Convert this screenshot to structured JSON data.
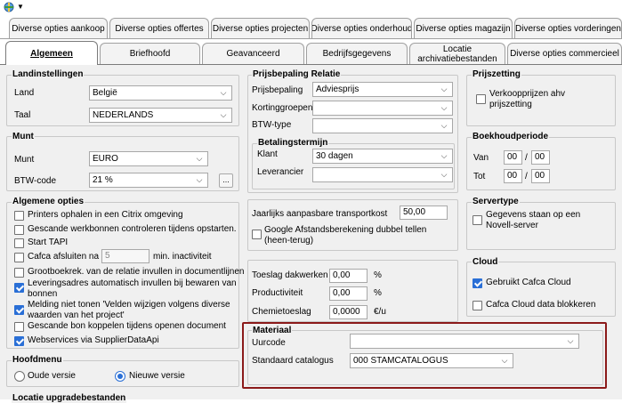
{
  "tabs_row1": [
    "Diverse opties aankoop",
    "Diverse opties offertes",
    "Diverse opties projecten",
    "Diverse opties onderhoud",
    "Diverse opties magazijn",
    "Diverse opties vorderingen"
  ],
  "tabs_row2": [
    "Algemeen",
    "Briefhoofd",
    "Geavanceerd",
    "Bedrijfsgegevens",
    "Locatie archivatiebestanden",
    "Diverse opties commercieel"
  ],
  "landinstellingen": {
    "title": "Landinstellingen",
    "land_label": "Land",
    "land_value": "België",
    "taal_label": "Taal",
    "taal_value": "NEDERLANDS"
  },
  "munt": {
    "title": "Munt",
    "munt_label": "Munt",
    "munt_value": "EURO",
    "btw_label": "BTW-code",
    "btw_value": "21 %",
    "dots": "..."
  },
  "algemene_opties": {
    "title": "Algemene opties",
    "printers": "Printers ophalen in een Citrix omgeving",
    "gescande": "Gescande werkbonnen controleren tijdens opstarten.",
    "tapi": "Start TAPI",
    "cafca_pre": "Cafca afsluiten na",
    "cafca_value": "5",
    "cafca_post": "min. inactiviteit",
    "grootboek": "Grootboekrek. van de relatie invullen in documentlijnen",
    "leverings1": "Leveringsadres automatisch invullen bij bewaren van",
    "leverings2": "bonnen",
    "melding1": "Melding niet tonen 'Velden wijzigen volgens diverse",
    "melding2": "waarden van het project'",
    "gescande_bon": "Gescande bon koppelen tijdens openen document",
    "webservices": "Webservices via SupplierDataApi"
  },
  "hoofdmenu": {
    "title": "Hoofdmenu",
    "oude": "Oude versie",
    "nieuwe": "Nieuwe versie"
  },
  "locatie_upgrade": {
    "title": "Locatie upgradebestanden"
  },
  "prijsbepaling": {
    "title": "Prijsbepaling Relatie",
    "prijsbepaling_label": "Prijsbepaling",
    "prijsbepaling_value": "Adviesprijs",
    "korting_label": "Kortinggroepen",
    "btw_type_label": "BTW-type"
  },
  "betalingstermijn": {
    "title": "Betalingstermijn",
    "klant_label": "Klant",
    "klant_value": "30 dagen",
    "leverancier_label": "Leverancier"
  },
  "aanpassing": {
    "jaarlijks_label": "Jaarlijks aanpasbare transportkost",
    "jaarlijks_value": "50,00",
    "google1": "Google Afstandsberekening dubbel tellen",
    "google2": "(heen-terug)"
  },
  "toeslag": {
    "dakwerken_label": "Toeslag dakwerken",
    "dakwerken_value": "0,00",
    "dakwerken_unit": "%",
    "product_label": "Productiviteit",
    "product_value": "0,00",
    "product_unit": "%",
    "chemie_label": "Chemietoeslag",
    "chemie_value": "0,0000",
    "chemie_unit": "€/u"
  },
  "materiaal": {
    "title": "Materiaal",
    "uurcode_label": "Uurcode",
    "uurcode_value": "",
    "catalogus_label": "Standaard catalogus",
    "catalogus_value": "000  STAMCATALOGUS"
  },
  "prijszetting": {
    "title": "Prijszetting",
    "verkoop1": "Verkoopprijzen ahv",
    "verkoop2": "prijszetting"
  },
  "boekhoudperiode": {
    "title": "Boekhoudperiode",
    "van_label": "Van",
    "tot_label": "Tot",
    "van_1": "00",
    "van_2": "00",
    "tot_1": "00",
    "tot_2": "00",
    "sep": "/"
  },
  "servertype": {
    "title": "Servertype",
    "novell1": "Gegevens staan op een",
    "novell2": "Novell-server"
  },
  "cloud": {
    "title": "Cloud",
    "gebruikt": "Gebruikt Cafca Cloud",
    "blokkeren": "Cafca Cloud data blokkeren"
  },
  "colors": {
    "highlight": "#8b1a1a",
    "accent": "#2a6fd6"
  }
}
